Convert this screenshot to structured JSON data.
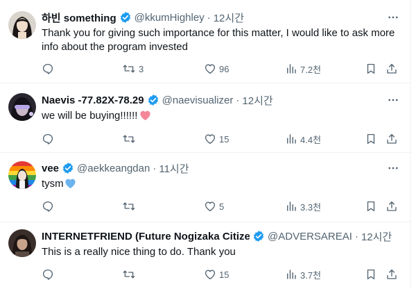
{
  "tweets": [
    {
      "name": "하빈 something",
      "handle": "@kkumHighley",
      "time": "12시간",
      "text": "Thank you for giving such importance for this matter, I would like to ask more info about the program invested",
      "replies": "",
      "retweets": "3",
      "likes": "96",
      "views": "7.2천"
    },
    {
      "name": "Naevis -77.82X-78.29",
      "handle": "@naevisualizer",
      "time": "12시간",
      "text": "we will be buying!!!!!!",
      "emoji": "pink-heart",
      "replies": "",
      "retweets": "",
      "likes": "15",
      "views": "4.4천"
    },
    {
      "name": "vee",
      "handle": "@aekkeangdan",
      "time": "11시간",
      "text": "tysm",
      "emoji": "blue-heart",
      "replies": "",
      "retweets": "",
      "likes": "5",
      "views": "3.3천"
    },
    {
      "name": "INTERNETFRIEND (Future Nogizaka Citizei",
      "handle": "@ADVERSAREAI",
      "time": "12시간",
      "text": "This is a really nice thing to do. Thank you",
      "replies": "",
      "retweets": "",
      "likes": "15",
      "views": "3.7천"
    }
  ],
  "icons": {
    "reply": "reply-icon",
    "retweet": "retweet-icon",
    "like": "heart-icon",
    "views": "views-icon",
    "bookmark": "bookmark-icon",
    "share": "share-icon",
    "more": "more-dots-icon",
    "verified": "verified-badge-icon"
  },
  "colors": {
    "verified": "#1d9bf0",
    "secondary_text": "#536471",
    "pink_heart": "#f4869a",
    "blue_heart": "#6cb4ee"
  }
}
